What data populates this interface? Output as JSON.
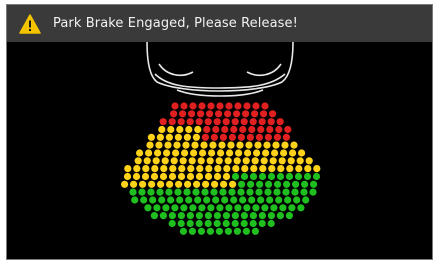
{
  "alert": {
    "icon": "warning-triangle-icon",
    "message": "Park Brake Engaged, Please Release!",
    "icon_color": "#f5c400"
  },
  "parking_sensor": {
    "vehicle_icon": "car-front-outline-icon",
    "zone_colors": {
      "far": "#ffd21a",
      "middle": "#ffd21a",
      "near": "#e02020",
      "outer": "#1fbf1f"
    }
  }
}
